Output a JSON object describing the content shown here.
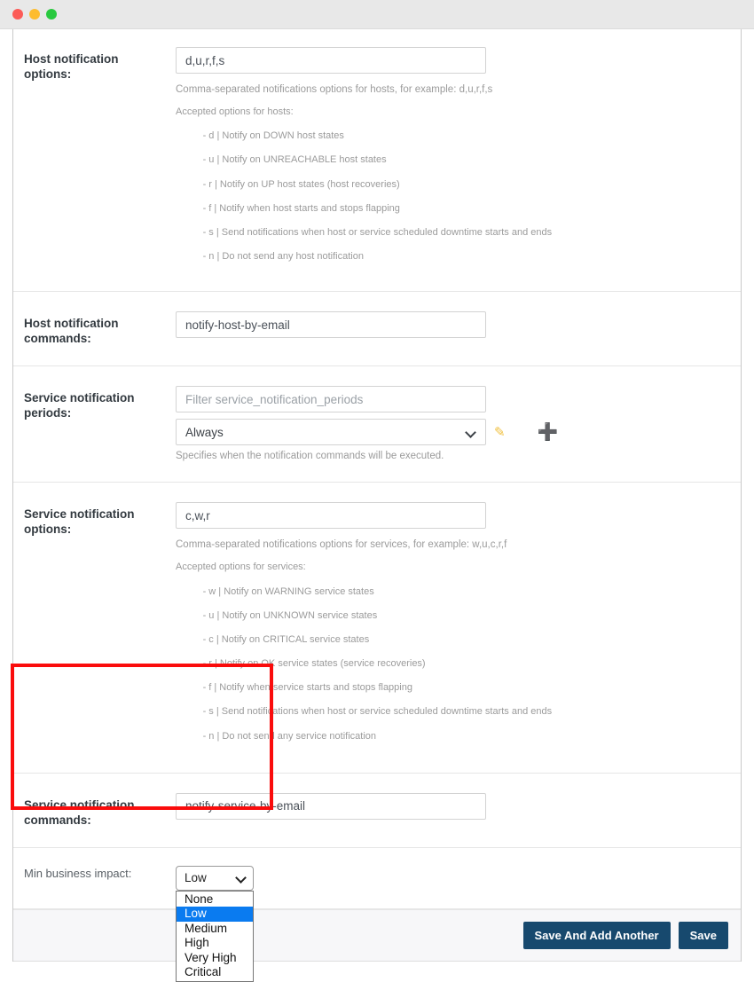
{
  "window": {
    "traffic_lights": [
      "close-red",
      "minimize-yellow",
      "maximize-green"
    ]
  },
  "form": {
    "rows": [
      {
        "id": "host-notification-options",
        "label": "Host notification options:",
        "value": "d,u,r,f,s",
        "help": "Comma-separated notifications options for hosts, for example: d,u,r,f,s",
        "accepted_title": "Accepted options for hosts:",
        "accepted": [
          "- d | Notify on DOWN host states",
          "- u | Notify on UNREACHABLE host states",
          "- r | Notify on UP host states (host recoveries)",
          "- f | Notify when host starts and stops flapping",
          "- s | Send notifications when host or service scheduled downtime starts and ends",
          "- n | Do not send any host notification"
        ]
      },
      {
        "id": "host-notification-commands",
        "label": "Host notification commands:",
        "value": "notify-host-by-email"
      },
      {
        "id": "service-notification-periods",
        "label": "Service notification periods:",
        "filter_placeholder": "Filter service_notification_periods",
        "selected": "Always",
        "help": "Specifies when the notification commands will be executed.",
        "edit_icon": "pencil-icon",
        "add_icon": "plus-icon"
      },
      {
        "id": "service-notification-options",
        "label": "Service notification options:",
        "value": "c,w,r",
        "help": "Comma-separated notifications options for services, for example: w,u,c,r,f",
        "accepted_title": "Accepted options for services:",
        "accepted": [
          "- w | Notify on WARNING service states",
          "- u | Notify on UNKNOWN service states",
          "- c | Notify on CRITICAL service states",
          "- r | Notify on OK service states (service recoveries)",
          "- f | Notify when service starts and stops flapping",
          "- s | Send notifications when host or service scheduled downtime starts and ends",
          "- n | Do not send any service notification"
        ]
      },
      {
        "id": "service-notification-commands",
        "label": "Service notification commands:",
        "value": "notify-service-by-email"
      }
    ],
    "min_business_impact": {
      "label": "Min business impact:",
      "selected": "Low",
      "options": [
        "None",
        "Low",
        "Medium",
        "High",
        "Very High",
        "Critical"
      ]
    },
    "footer": {
      "save_and_add_another_label": "Save And Add Another",
      "save_label": "Save"
    }
  },
  "annotation": {
    "highlight_color": "#fa0c0c"
  }
}
